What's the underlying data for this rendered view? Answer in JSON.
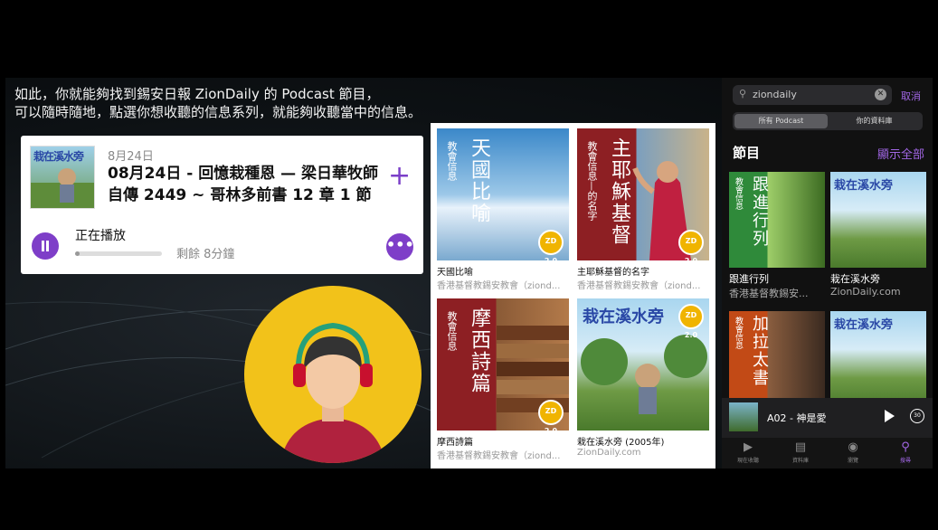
{
  "caption": {
    "line1": "如此，你就能夠找到錫安日報 ZionDaily 的 Podcast 節目，",
    "line2": "可以隨時隨地，點選你想收聽的信息系列，就能夠收聽當中的信息。"
  },
  "now_playing": {
    "date": "8月24日",
    "title": "08月24日 - 回憶栽種恩 — 梁日華牧師自傳 2449 ~ 哥林多前書 12 章 1 節",
    "status": "正在播放",
    "remaining": "剩餘 8分鐘",
    "progress": 0.05,
    "thumb_text": "栽在溪水旁",
    "add_icon": "plus-icon",
    "more_icon": "more-icon"
  },
  "grid": {
    "tiles": [
      {
        "cover_big": "天國比喻",
        "cover_small": "教會信息",
        "title": "天國比喻",
        "author": "香港基督教錫安教會（ziond..."
      },
      {
        "cover_big": "主耶穌基督",
        "cover_small": "教會信息—的名字",
        "title": "主耶穌基督的名字",
        "author": "香港基督教錫安教會（ziond..."
      },
      {
        "cover_big": "摩西詩篇",
        "cover_small": "教會信息",
        "title": "摩西詩篇",
        "author": "香港基督教錫安教會（ziond..."
      },
      {
        "cover_big": "栽在溪水旁",
        "cover_small": "",
        "title": "栽在溪水旁 (2005年)",
        "author": "ZionDaily.com"
      }
    ],
    "badge": "ZD 2.0"
  },
  "phone": {
    "search_query": "ziondaily",
    "cancel": "取消",
    "segments": [
      "所有 Podcast",
      "你的資料庫"
    ],
    "section_title": "節目",
    "show_all": "顯示全部",
    "tiles": [
      {
        "cover_big": "跟進行列",
        "cover_small": "教會信息",
        "title": "跟進行列",
        "author": "香港基督教錫安..."
      },
      {
        "cover_big": "栽在溪水旁",
        "cover_small": "",
        "title": "栽在溪水旁",
        "author": "ZionDaily.com"
      },
      {
        "cover_big": "加拉太書",
        "cover_small": "教會信息",
        "title": "",
        "author": ""
      },
      {
        "cover_big": "栽在溪水旁",
        "cover_small": "",
        "title": "",
        "author": ""
      }
    ],
    "mini_player": {
      "title": "A02 - 神是愛",
      "skip": "30"
    },
    "tabs": [
      {
        "label": "現在收聽",
        "icon": "play-circle-icon"
      },
      {
        "label": "資料庫",
        "icon": "library-icon"
      },
      {
        "label": "瀏覽",
        "icon": "podcast-icon"
      },
      {
        "label": "搜尋",
        "icon": "search-icon"
      }
    ]
  },
  "colors": {
    "accent": "#7e3ec8",
    "phone_accent": "#a267e6",
    "avatar_bg": "#f2c21a"
  }
}
